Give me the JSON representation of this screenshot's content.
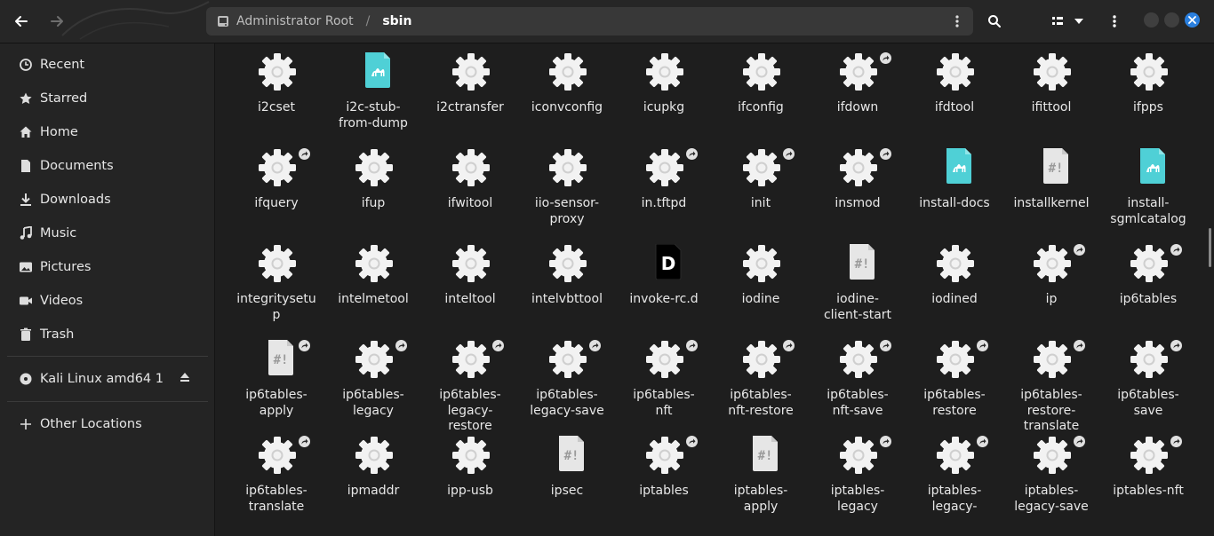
{
  "header": {
    "path": {
      "root_label": "Administrator Root",
      "separator": "/",
      "current": "sbin"
    },
    "icons": [
      "back-icon",
      "forward-icon",
      "drive-icon",
      "path-menu-icon",
      "search-icon",
      "view-list-icon",
      "view-dropdown-icon",
      "main-menu-icon"
    ],
    "close_color": "#2a7fde"
  },
  "sidebar": {
    "items": [
      {
        "label": "Recent",
        "icon": "clock-icon"
      },
      {
        "label": "Starred",
        "icon": "star-icon"
      },
      {
        "label": "Home",
        "icon": "home-icon"
      },
      {
        "label": "Documents",
        "icon": "document-icon"
      },
      {
        "label": "Downloads",
        "icon": "download-icon"
      },
      {
        "label": "Music",
        "icon": "music-icon"
      },
      {
        "label": "Pictures",
        "icon": "picture-icon"
      },
      {
        "label": "Videos",
        "icon": "video-icon"
      },
      {
        "label": "Trash",
        "icon": "trash-icon"
      }
    ],
    "device": {
      "label": "Kali Linux amd64 1",
      "icon": "disc-icon"
    },
    "other": {
      "label": "Other Locations",
      "icon": "plus-icon"
    }
  },
  "files": [
    {
      "name": "i2cset",
      "type": "gear",
      "link": false
    },
    {
      "name": "i2c-stub-from-dump",
      "type": "camel",
      "link": false
    },
    {
      "name": "i2ctransfer",
      "type": "gear",
      "link": false
    },
    {
      "name": "iconvconfig",
      "type": "gear",
      "link": false
    },
    {
      "name": "icupkg",
      "type": "gear",
      "link": false
    },
    {
      "name": "ifconfig",
      "type": "gear",
      "link": false
    },
    {
      "name": "ifdown",
      "type": "gear",
      "link": true
    },
    {
      "name": "ifdtool",
      "type": "gear",
      "link": false
    },
    {
      "name": "ifittool",
      "type": "gear",
      "link": false
    },
    {
      "name": "ifpps",
      "type": "gear",
      "link": false
    },
    {
      "name": "ifquery",
      "type": "gear",
      "link": true
    },
    {
      "name": "ifup",
      "type": "gear",
      "link": false
    },
    {
      "name": "ifwitool",
      "type": "gear",
      "link": false
    },
    {
      "name": "iio-sensor-proxy",
      "type": "gear",
      "link": false
    },
    {
      "name": "in.tftpd",
      "type": "gear",
      "link": true
    },
    {
      "name": "init",
      "type": "gear",
      "link": true
    },
    {
      "name": "insmod",
      "type": "gear",
      "link": true
    },
    {
      "name": "install-docs",
      "type": "camel",
      "link": false
    },
    {
      "name": "installkernel",
      "type": "script",
      "link": false
    },
    {
      "name": "install-sgmlcatalog",
      "type": "camel",
      "link": false
    },
    {
      "name": "integritysetup",
      "type": "gear",
      "link": false
    },
    {
      "name": "intelmetool",
      "type": "gear",
      "link": false
    },
    {
      "name": "inteltool",
      "type": "gear",
      "link": false
    },
    {
      "name": "intelvbttool",
      "type": "gear",
      "link": false
    },
    {
      "name": "invoke-rc.d",
      "type": "d",
      "link": false
    },
    {
      "name": "iodine",
      "type": "gear",
      "link": false
    },
    {
      "name": "iodine-client-start",
      "type": "script",
      "link": false
    },
    {
      "name": "iodined",
      "type": "gear",
      "link": false
    },
    {
      "name": "ip",
      "type": "gear",
      "link": true
    },
    {
      "name": "ip6tables",
      "type": "gear",
      "link": true
    },
    {
      "name": "ip6tables-apply",
      "type": "script",
      "link": true
    },
    {
      "name": "ip6tables-legacy",
      "type": "gear",
      "link": true
    },
    {
      "name": "ip6tables-legacy-restore",
      "type": "gear",
      "link": true
    },
    {
      "name": "ip6tables-legacy-save",
      "type": "gear",
      "link": true
    },
    {
      "name": "ip6tables-nft",
      "type": "gear",
      "link": true
    },
    {
      "name": "ip6tables-nft-restore",
      "type": "gear",
      "link": true
    },
    {
      "name": "ip6tables-nft-save",
      "type": "gear",
      "link": true
    },
    {
      "name": "ip6tables-restore",
      "type": "gear",
      "link": true
    },
    {
      "name": "ip6tables-restore-translate",
      "type": "gear",
      "link": true
    },
    {
      "name": "ip6tables-save",
      "type": "gear",
      "link": true
    },
    {
      "name": "ip6tables-translate",
      "type": "gear",
      "link": true
    },
    {
      "name": "ipmaddr",
      "type": "gear",
      "link": false
    },
    {
      "name": "ipp-usb",
      "type": "gear",
      "link": false
    },
    {
      "name": "ipsec",
      "type": "script",
      "link": false
    },
    {
      "name": "iptables",
      "type": "gear",
      "link": true
    },
    {
      "name": "iptables-apply",
      "type": "script",
      "link": false
    },
    {
      "name": "iptables-legacy",
      "type": "gear",
      "link": true
    },
    {
      "name": "iptables-legacy-",
      "type": "gear",
      "link": true
    },
    {
      "name": "iptables-legacy-save",
      "type": "gear",
      "link": true
    },
    {
      "name": "iptables-nft",
      "type": "gear",
      "link": true
    }
  ],
  "display_names": [
    [
      "i2cset"
    ],
    [
      "i2c-stub-",
      "from-dump"
    ],
    [
      "i2ctransfer"
    ],
    [
      "iconvconfig"
    ],
    [
      "icupkg"
    ],
    [
      "ifconfig"
    ],
    [
      "ifdown"
    ],
    [
      "ifdtool"
    ],
    [
      "ifittool"
    ],
    [
      "ifpps"
    ],
    [
      "ifquery"
    ],
    [
      "ifup"
    ],
    [
      "ifwitool"
    ],
    [
      "iio-sensor-",
      "proxy"
    ],
    [
      "in.tftpd"
    ],
    [
      "init"
    ],
    [
      "insmod"
    ],
    [
      "install-docs"
    ],
    [
      "installkernel"
    ],
    [
      "install-",
      "sgmlcatalog"
    ],
    [
      "integritysetu",
      "p"
    ],
    [
      "intelmetool"
    ],
    [
      "inteltool"
    ],
    [
      "intelvbttool"
    ],
    [
      "invoke-rc.d"
    ],
    [
      "iodine"
    ],
    [
      "iodine-",
      "client-start"
    ],
    [
      "iodined"
    ],
    [
      "ip"
    ],
    [
      "ip6tables"
    ],
    [
      "ip6tables-",
      "apply"
    ],
    [
      "ip6tables-",
      "legacy"
    ],
    [
      "ip6tables-",
      "legacy-",
      "restore"
    ],
    [
      "ip6tables-",
      "legacy-save"
    ],
    [
      "ip6tables-",
      "nft"
    ],
    [
      "ip6tables-",
      "nft-restore"
    ],
    [
      "ip6tables-",
      "nft-save"
    ],
    [
      "ip6tables-",
      "restore"
    ],
    [
      "ip6tables-",
      "restore-",
      "translate"
    ],
    [
      "ip6tables-",
      "save"
    ],
    [
      "ip6tables-",
      "translate"
    ],
    [
      "ipmaddr"
    ],
    [
      "ipp-usb"
    ],
    [
      "ipsec"
    ],
    [
      "iptables"
    ],
    [
      "iptables-",
      "apply"
    ],
    [
      "iptables-",
      "legacy"
    ],
    [
      "iptables-",
      "legacy-"
    ],
    [
      "iptables-",
      "legacy-save"
    ],
    [
      "iptables-nft"
    ]
  ]
}
